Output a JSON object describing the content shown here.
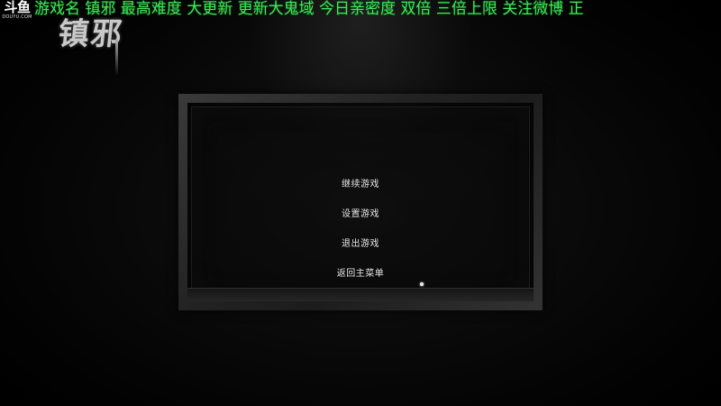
{
  "overlay": {
    "logo_name": "斗鱼",
    "logo_domain": "DOUYU.COM",
    "marquee_text": "游戏名 镇邪 最高难度 大更新 更新大鬼域  今日亲密度 双倍 三倍上限   关注微博  正",
    "marquee_color": "#3fe85a"
  },
  "game": {
    "title": "镇邪"
  },
  "pause_menu": {
    "items": [
      {
        "label": "继续游戏"
      },
      {
        "label": "设置游戏"
      },
      {
        "label": "退出游戏"
      },
      {
        "label": "返回主菜单"
      }
    ]
  }
}
